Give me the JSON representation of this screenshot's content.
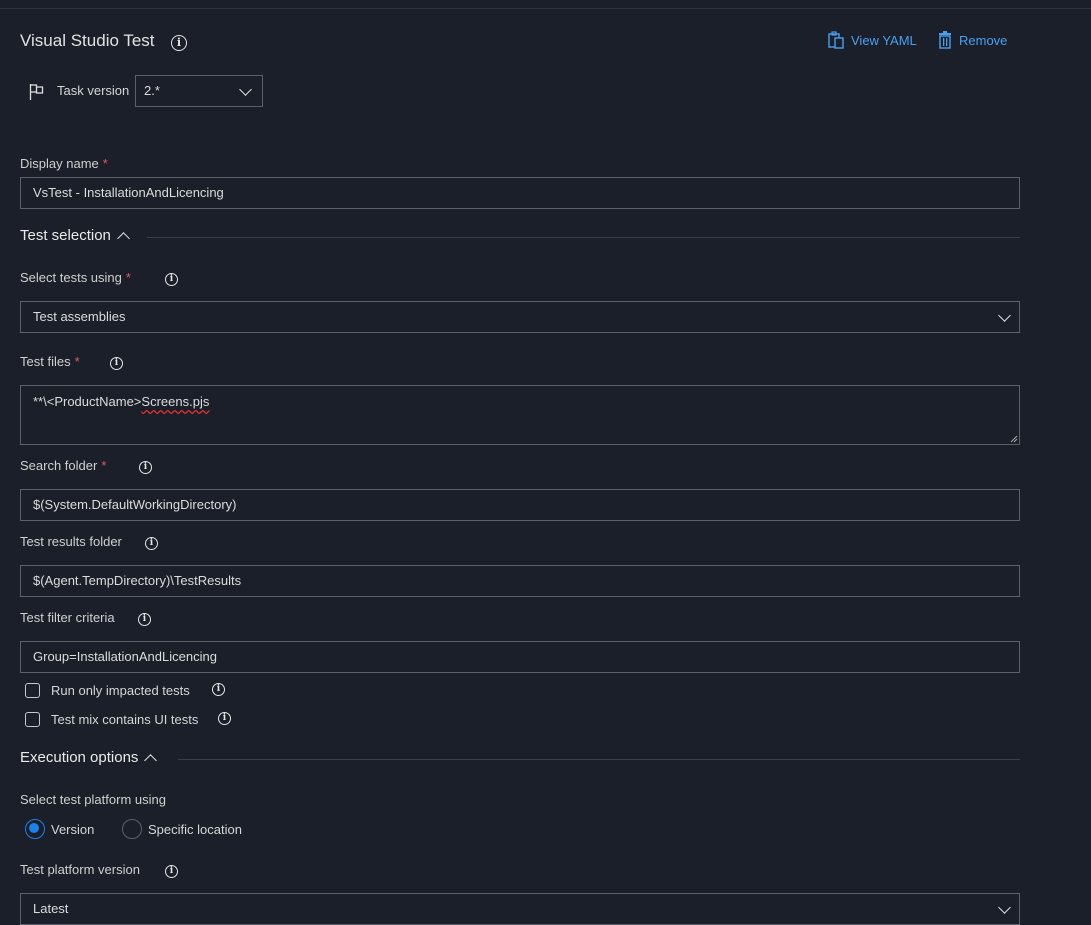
{
  "header": {
    "title": "Visual Studio Test",
    "view_yaml": "View YAML",
    "remove": "Remove"
  },
  "task_version": {
    "label": "Task version",
    "value": "2.*"
  },
  "display_name": {
    "label": "Display name",
    "required": "*",
    "value": "VsTest - InstallationAndLicencing"
  },
  "test_selection": {
    "title": "Test selection",
    "select_tests_using": {
      "label": "Select tests using",
      "required": "*",
      "value": "Test assemblies"
    },
    "test_files": {
      "label": "Test files",
      "required": "*",
      "value_prefix": "**\\<ProductName>",
      "value_misspelled": "Screens.pjs"
    },
    "search_folder": {
      "label": "Search folder",
      "required": "*",
      "value": "$(System.DefaultWorkingDirectory)"
    },
    "test_results_folder": {
      "label": "Test results folder",
      "value": "$(Agent.TempDirectory)\\TestResults"
    },
    "test_filter_criteria": {
      "label": "Test filter criteria",
      "value": "Group=InstallationAndLicencing"
    },
    "run_only_impacted": {
      "label": "Run only impacted tests",
      "checked": false
    },
    "ui_tests": {
      "label": "Test mix contains UI tests",
      "checked": false
    }
  },
  "execution_options": {
    "title": "Execution options",
    "platform_label": "Select test platform using",
    "radio_version": "Version",
    "radio_specific": "Specific location",
    "selected": "Version",
    "platform_version": {
      "label": "Test platform version",
      "value": "Latest"
    }
  },
  "colors": {
    "background": "#1b1f29",
    "accent": "#4aa0f0",
    "required": "#e05c5c",
    "radio_selected": "#1a82e8"
  }
}
